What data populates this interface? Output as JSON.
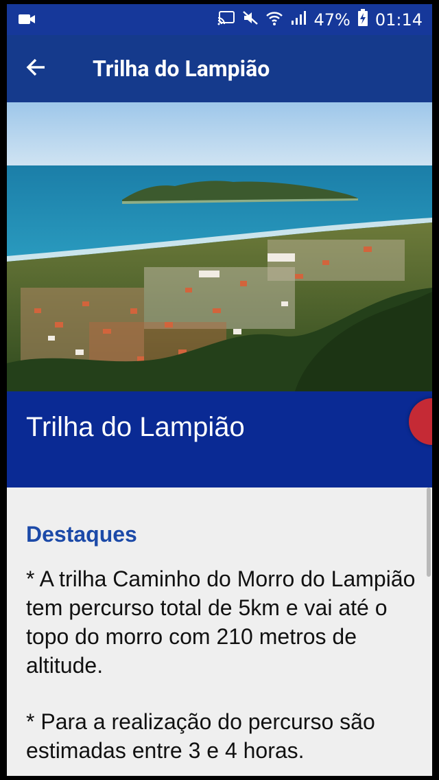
{
  "status_bar": {
    "battery": "47%",
    "time": "01:14",
    "icons": [
      "video-icon",
      "cast-icon",
      "mute-icon",
      "wifi-icon",
      "signal-icon",
      "battery-charging-icon"
    ]
  },
  "app_bar": {
    "title": "Trilha do Lampião",
    "back_icon": "arrow-back-icon"
  },
  "hero": {
    "image": "aerial view of coastal town, sea and island"
  },
  "banner": {
    "title": "Trilha do Lampião"
  },
  "content": {
    "heading": "Destaques",
    "paragraph_1": "* A trilha Caminho do Morro do Lampião tem percurso total de 5km e vai até o topo do morro com 210 metros de altitude.",
    "paragraph_2": "* Para a realização do percurso são estimadas entre 3 e 4 horas."
  },
  "colors": {
    "status_bar": "#16389a",
    "app_bar": "#153a8c",
    "banner": "#0a2a94",
    "heading": "#1c4aa8",
    "background": "#efefef"
  }
}
